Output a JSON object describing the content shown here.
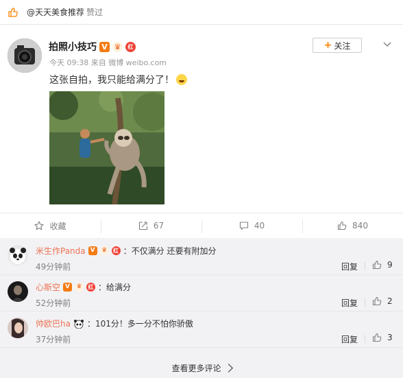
{
  "like_bar": {
    "user": "@天天美食推荐",
    "suffix": "赞过"
  },
  "post": {
    "author": "拍照小技巧",
    "badge_v": "V",
    "badge_red": "红",
    "follow_label": "关注",
    "follow_plus": "+",
    "meta": "今天 09:38 来自 微博 weibo.com",
    "text": "这张自拍，我只能给满分了！"
  },
  "actions": {
    "favorite": "收藏",
    "repost": "67",
    "comment": "40",
    "like": "840"
  },
  "comments": [
    {
      "user": "米生作Panda",
      "text": "：不仅满分 还要有附加分",
      "time": "49分钟前",
      "reply": "回复",
      "likes": "9",
      "badge_red": "红"
    },
    {
      "user": "心斯空",
      "text": "：给满分",
      "time": "52分钟前",
      "reply": "回复",
      "likes": "2",
      "badge_red": "红"
    },
    {
      "user": "帅欧巴ha",
      "text": "：101分！多一分不怕你骄傲",
      "time": "37分钟前",
      "reply": "回复",
      "likes": "3"
    }
  ],
  "more": "查看更多评论",
  "colors": {
    "accent": "#ff8200",
    "comment_user": "#eb7350",
    "comment_bg": "#f2f2f5"
  }
}
